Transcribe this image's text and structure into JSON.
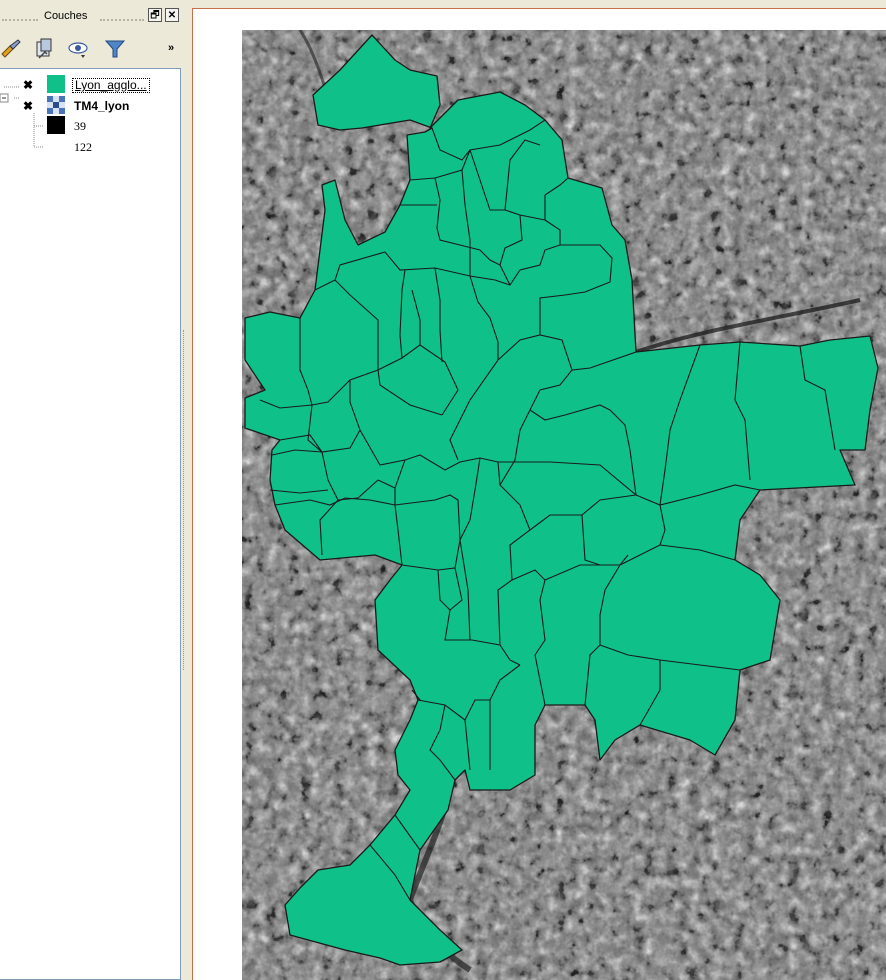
{
  "panel": {
    "title": "Couches",
    "float_button": "🗗",
    "close_button": "✕",
    "overflow_chevron": "»"
  },
  "toolbar": {
    "icons": [
      "paint-brush-icon",
      "layer-properties-icon",
      "eye-visibility-icon",
      "filter-icon"
    ]
  },
  "layers": [
    {
      "name": "Lyon_agglo...",
      "checked_mark": "✖",
      "swatch_color": "#0fc188",
      "type": "vector"
    },
    {
      "name": "TM4_lyon",
      "checked_mark": "✖",
      "type": "raster",
      "legend": [
        {
          "label": "39",
          "color": "#000000"
        },
        {
          "label": "122",
          "color": "#ffffff"
        }
      ]
    }
  ],
  "map": {
    "fill_color": "#0fc188",
    "background": "grayscale satellite raster"
  }
}
